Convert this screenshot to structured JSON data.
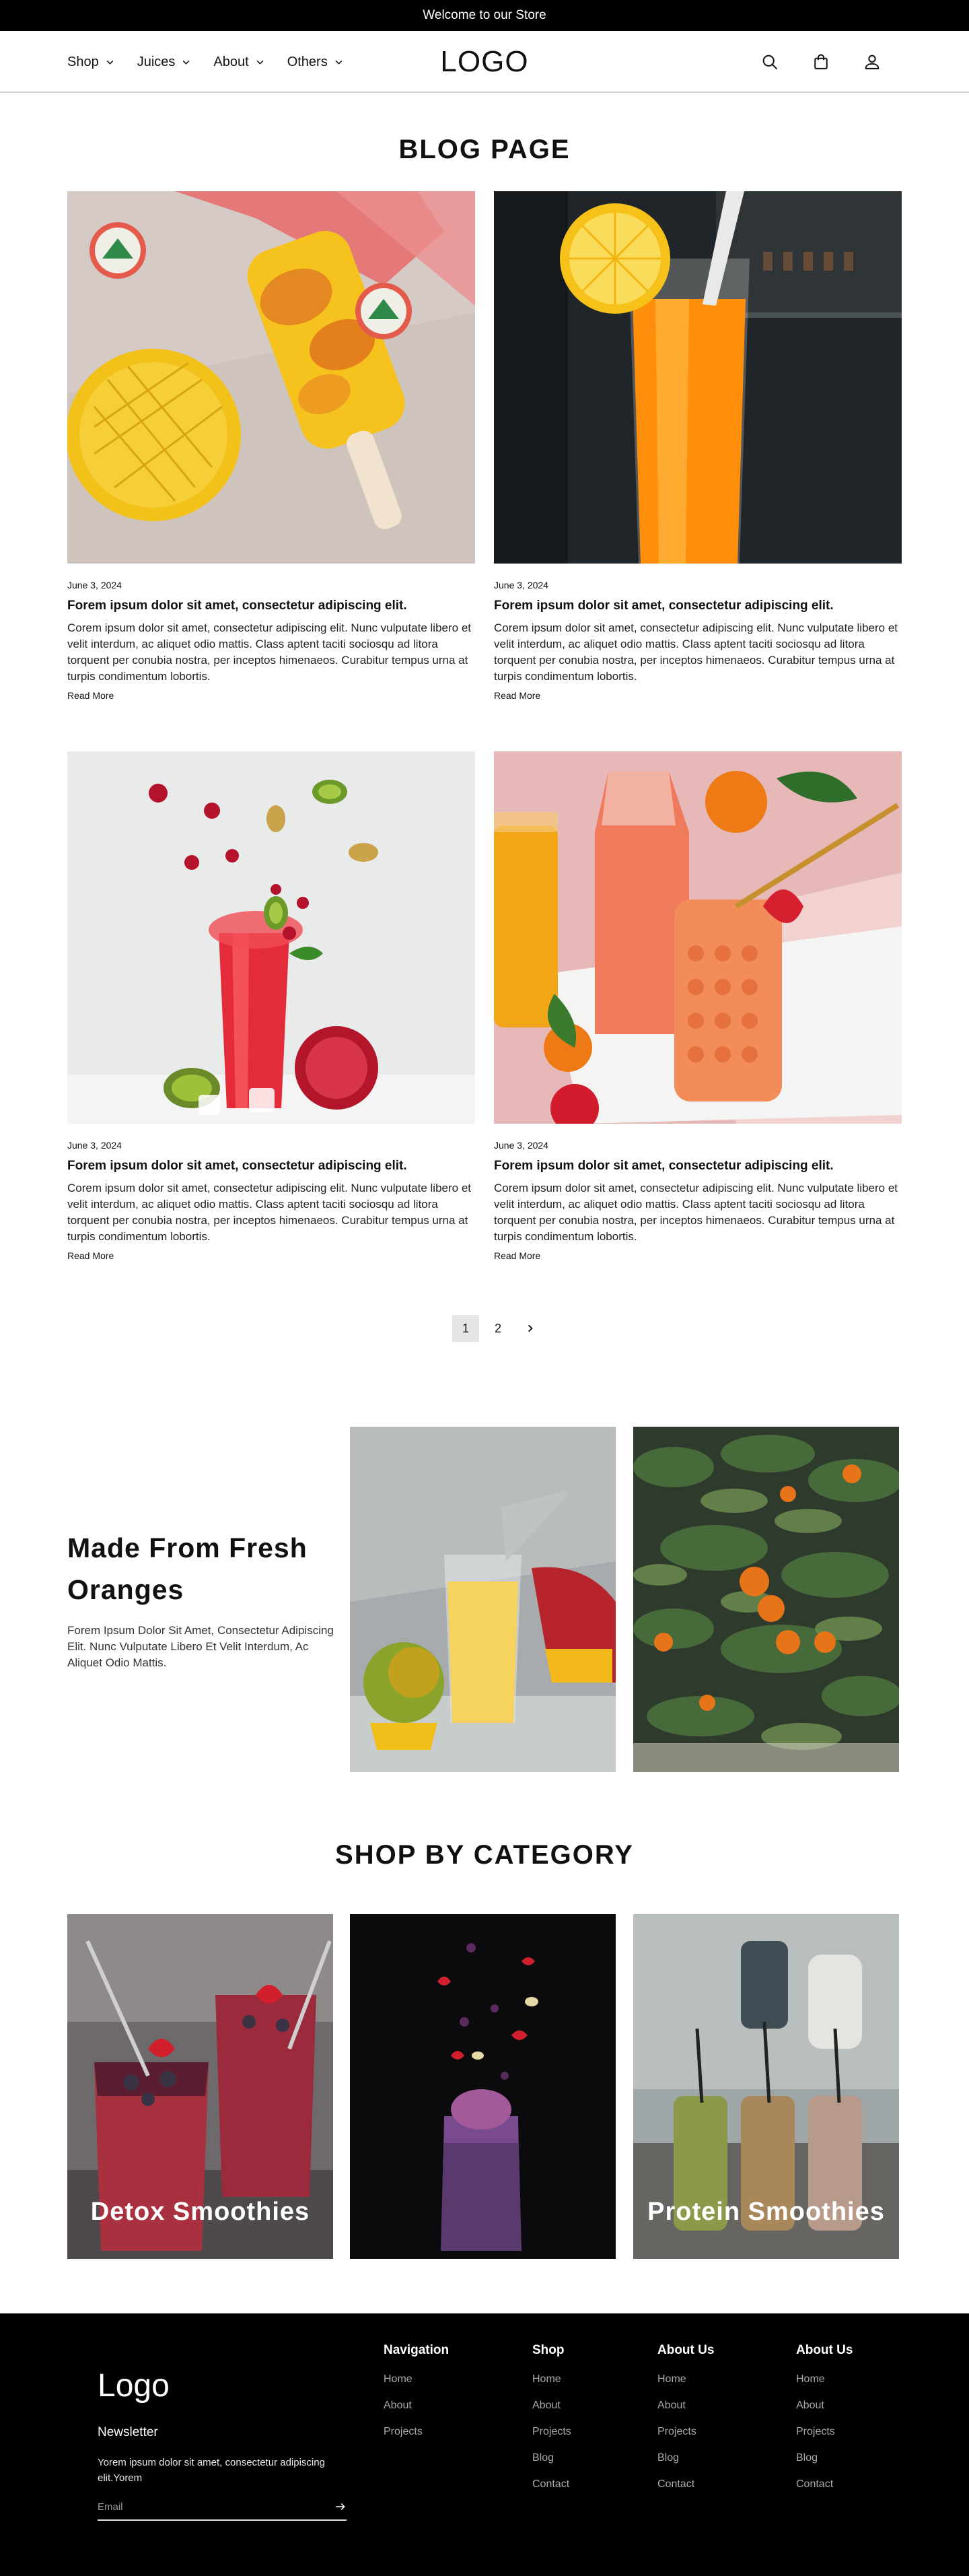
{
  "topbar": {
    "text": "Welcome to our Store"
  },
  "header": {
    "nav": [
      {
        "label": "Shop"
      },
      {
        "label": "Juices"
      },
      {
        "label": "About"
      },
      {
        "label": "Others"
      }
    ],
    "logo": "LOGO"
  },
  "page_title": "BLOG PAGE",
  "posts": [
    {
      "date": "June 3, 2024",
      "title": "Forem ipsum dolor sit amet, consectetur adipiscing elit.",
      "text": "Corem ipsum dolor sit amet, consectetur adipiscing elit. Nunc vulputate libero et velit interdum, ac aliquet odio mattis. Class aptent taciti sociosqu ad litora torquent per conubia nostra, per inceptos himenaeos. Curabitur tempus urna at turpis condimentum lobortis.",
      "read_more": "Read More"
    },
    {
      "date": "June 3, 2024",
      "title": "Forem ipsum dolor sit amet, consectetur adipiscing elit.",
      "text": "Corem ipsum dolor sit amet, consectetur adipiscing elit. Nunc vulputate libero et velit interdum, ac aliquet odio mattis. Class aptent taciti sociosqu ad litora torquent per conubia nostra, per inceptos himenaeos. Curabitur tempus urna at turpis condimentum lobortis.",
      "read_more": "Read More"
    },
    {
      "date": "June 3, 2024",
      "title": "Forem ipsum dolor sit amet, consectetur adipiscing elit.",
      "text": "Corem ipsum dolor sit amet, consectetur adipiscing elit. Nunc vulputate libero et velit interdum, ac aliquet odio mattis. Class aptent taciti sociosqu ad litora torquent per conubia nostra, per inceptos himenaeos. Curabitur tempus urna at turpis condimentum lobortis.",
      "read_more": "Read More"
    },
    {
      "date": "June 3, 2024",
      "title": "Forem ipsum dolor sit amet, consectetur adipiscing elit.",
      "text": "Corem ipsum dolor sit amet, consectetur adipiscing elit. Nunc vulputate libero et velit interdum, ac aliquet odio mattis. Class aptent taciti sociosqu ad litora torquent per conubia nostra, per inceptos himenaeos. Curabitur tempus urna at turpis condimentum lobortis.",
      "read_more": "Read More"
    }
  ],
  "pagination": {
    "pages": [
      "1",
      "2"
    ],
    "current": "1"
  },
  "fresh": {
    "title": "Made From Fresh Oranges",
    "text": "Forem Ipsum Dolor Sit Amet, Consectetur Adipiscing Elit. Nunc Vulputate Libero Et Velit Interdum, Ac Aliquet Odio Mattis."
  },
  "categories_title": "SHOP BY CATEGORY",
  "categories": [
    {
      "label": "Detox Smoothies"
    },
    {
      "label": ""
    },
    {
      "label": "Protein Smoothies"
    }
  ],
  "footer": {
    "logo": "Logo",
    "newsletter_title": "Newsletter",
    "newsletter_text": "Yorem ipsum dolor sit amet, consectetur adipiscing elit.Yorem",
    "email_placeholder": "Email",
    "columns": [
      {
        "title": "Navigation",
        "links": [
          "Home",
          "About",
          "Projects"
        ]
      },
      {
        "title": "Shop",
        "links": [
          "Home",
          "About",
          "Projects",
          "Blog",
          "Contact"
        ]
      },
      {
        "title": "About Us",
        "links": [
          "Home",
          "About",
          "Projects",
          "Blog",
          "Contact"
        ]
      },
      {
        "title": "About Us",
        "links": [
          "Home",
          "About",
          "Projects",
          "Blog",
          "Contact"
        ]
      }
    ]
  },
  "colors": {
    "topbar_bg": "#000000",
    "footer_bg": "#000000",
    "pager_active_bg": "#e6e6e6"
  },
  "icons": [
    "chevron-down-icon",
    "search-icon",
    "bag-icon",
    "user-icon",
    "chevron-right-icon",
    "arrow-right-icon"
  ]
}
